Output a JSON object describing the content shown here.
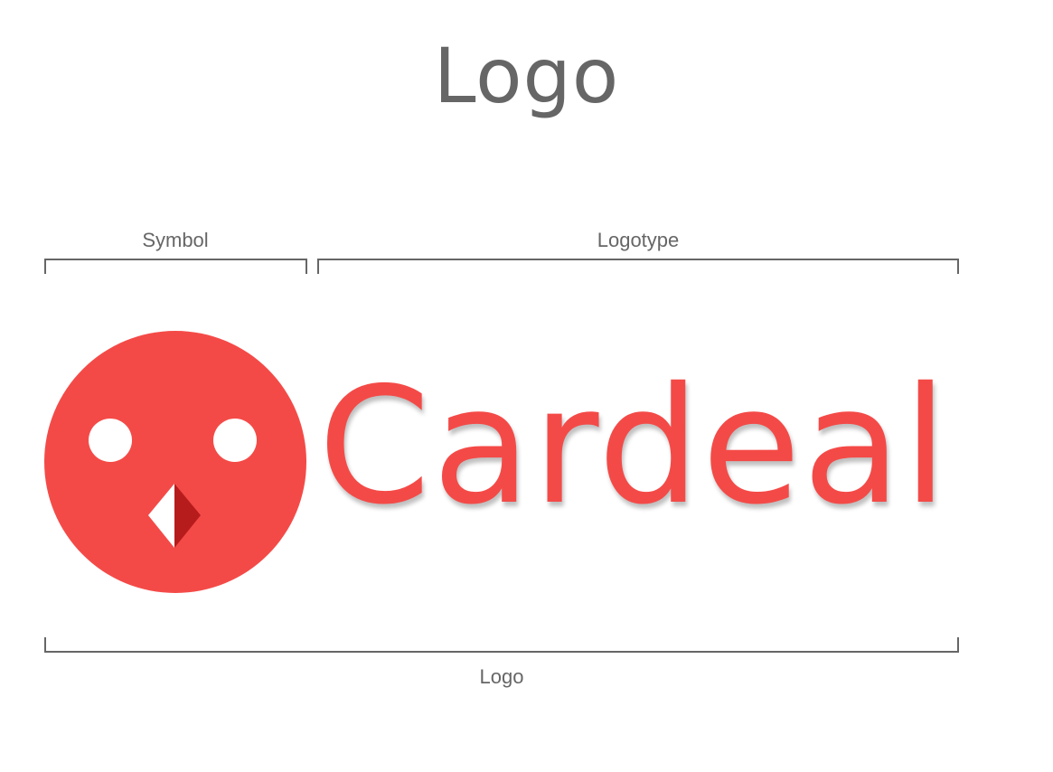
{
  "header": {
    "title": "Logo"
  },
  "annotations": {
    "symbol_label": "Symbol",
    "logotype_label": "Logotype",
    "logo_label": "Logo"
  },
  "brand": {
    "wordmark": "Cardeal",
    "colors": {
      "primary": "#f44a47",
      "beak_shadow": "#b71c1c",
      "eyes": "#ffffff",
      "annotation": "#666666"
    },
    "icon": "cardinal-bird-face-icon"
  }
}
